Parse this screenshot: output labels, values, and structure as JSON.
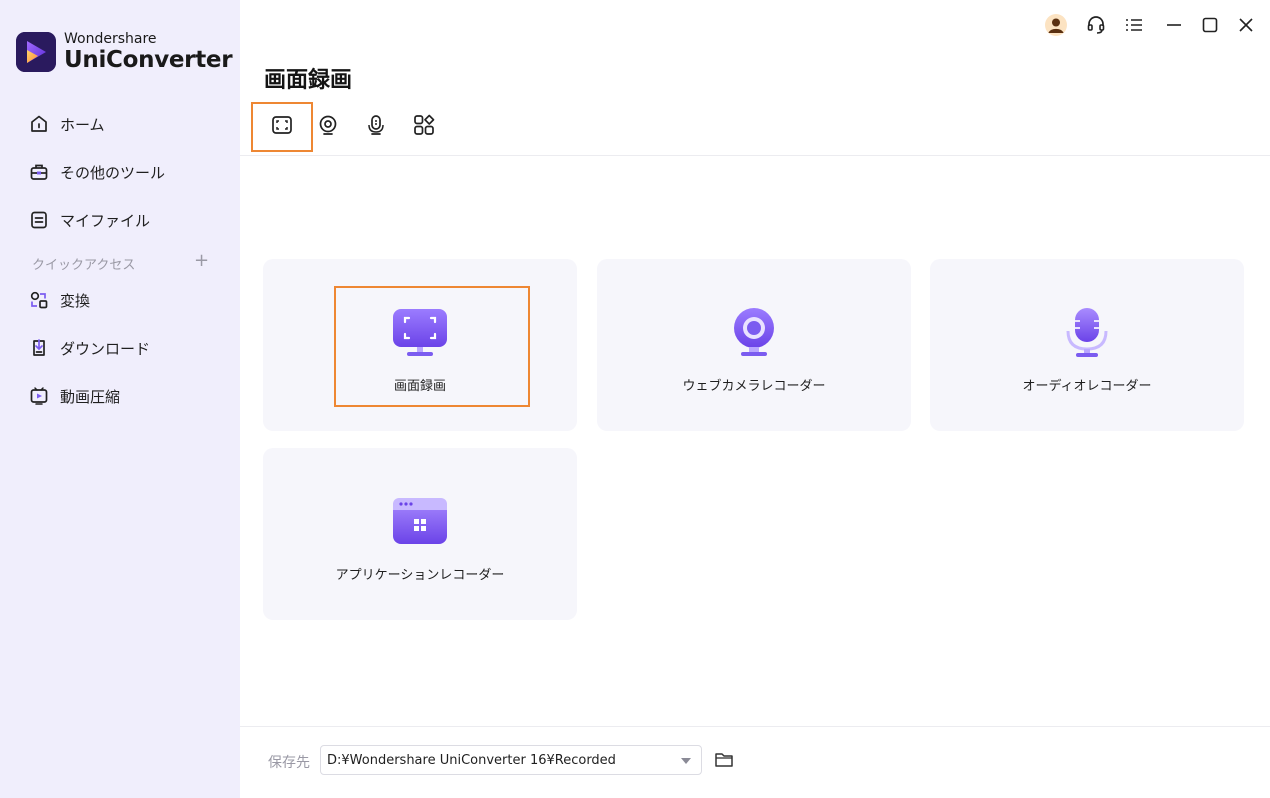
{
  "app": {
    "brand": "Wondershare",
    "product": "UniConverter"
  },
  "sidebar": {
    "items": [
      {
        "label": "ホーム",
        "icon": "home-icon"
      },
      {
        "label": "その他のツール",
        "icon": "toolbox-icon"
      },
      {
        "label": "マイファイル",
        "icon": "file-icon"
      }
    ],
    "quick_access_label": "クイックアクセス",
    "quick_access_add": "+",
    "quick_items": [
      {
        "label": "変換",
        "icon": "convert-icon"
      },
      {
        "label": "ダウンロード",
        "icon": "download-icon"
      },
      {
        "label": "動画圧縮",
        "icon": "compress-icon"
      }
    ]
  },
  "topbar": {
    "icons": [
      "avatar-icon",
      "headset-icon",
      "menu-icon",
      "minimize-icon",
      "maximize-icon",
      "close-icon"
    ]
  },
  "main": {
    "title": "画面録画",
    "tabs": [
      {
        "icon": "screen-record-tab-icon",
        "active": true
      },
      {
        "icon": "webcam-tab-icon",
        "active": false
      },
      {
        "icon": "audio-tab-icon",
        "active": false
      },
      {
        "icon": "apps-tab-icon",
        "active": false
      }
    ],
    "cards": [
      {
        "label": "画面録画",
        "icon": "screen-record-icon"
      },
      {
        "label": "ウェブカメラレコーダー",
        "icon": "webcam-icon"
      },
      {
        "label": "オーディオレコーダー",
        "icon": "microphone-icon"
      },
      {
        "label": "アプリケーションレコーダー",
        "icon": "app-window-icon"
      }
    ]
  },
  "footer": {
    "save_label": "保存先",
    "save_path": "D:¥Wondershare UniConverter 16¥Recorded"
  },
  "colors": {
    "accent_orange": "#ee8733",
    "purple": "#7b5cf0",
    "sidebar_bg": "#f0eefc",
    "card_bg": "#f6f6fb"
  }
}
